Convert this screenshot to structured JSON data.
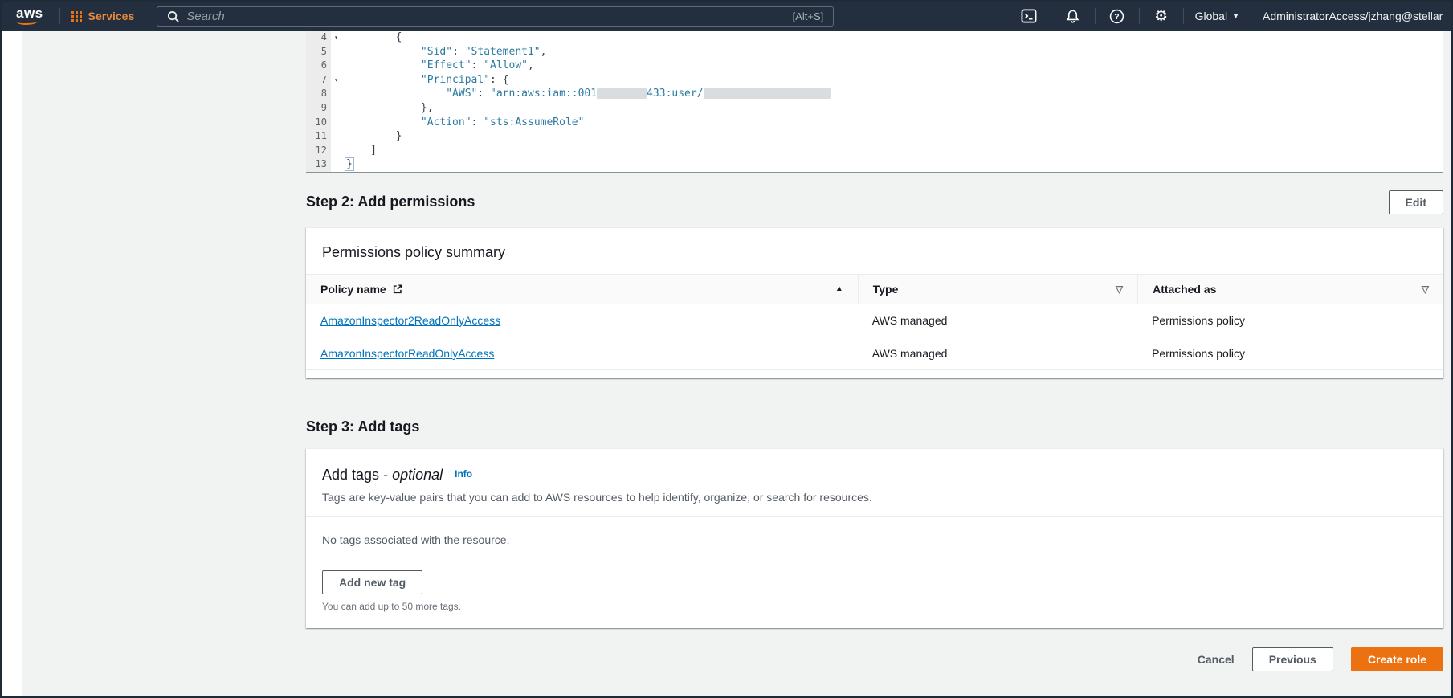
{
  "topbar": {
    "logo_text": "aws",
    "services_label": "Services",
    "search_placeholder": "Search",
    "search_shortcut": "[Alt+S]",
    "region_label": "Global",
    "account_label": "AdministratorAccess/jzhang@stellar"
  },
  "glyphs": {
    "sort_ascending": "▲",
    "filter": "▽",
    "caret_down": "▼",
    "fold_caret": "▾",
    "gear": "⚙"
  },
  "colors": {
    "topbar_navy": "#232f3e",
    "accent_orange": "#ec7211",
    "link_blue": "#0073bb",
    "code_string": "#2d7aa2",
    "page_background": "#f1f3f3"
  },
  "editor": {
    "lines": [
      {
        "num": "4",
        "fold": true,
        "segments": [
          {
            "type": "plain",
            "text": "        {"
          }
        ]
      },
      {
        "num": "5",
        "fold": false,
        "segments": [
          {
            "type": "plain",
            "text": "            "
          },
          {
            "type": "str",
            "text": "\"Sid\""
          },
          {
            "type": "plain",
            "text": ": "
          },
          {
            "type": "str",
            "text": "\"Statement1\""
          },
          {
            "type": "plain",
            "text": ","
          }
        ]
      },
      {
        "num": "6",
        "fold": false,
        "segments": [
          {
            "type": "plain",
            "text": "            "
          },
          {
            "type": "str",
            "text": "\"Effect\""
          },
          {
            "type": "plain",
            "text": ": "
          },
          {
            "type": "str",
            "text": "\"Allow\""
          },
          {
            "type": "plain",
            "text": ","
          }
        ]
      },
      {
        "num": "7",
        "fold": true,
        "segments": [
          {
            "type": "plain",
            "text": "            "
          },
          {
            "type": "str",
            "text": "\"Principal\""
          },
          {
            "type": "plain",
            "text": ": {"
          }
        ]
      },
      {
        "num": "8",
        "fold": false,
        "segments": [
          {
            "type": "plain",
            "text": "                "
          },
          {
            "type": "str",
            "text": "\"AWS\""
          },
          {
            "type": "plain",
            "text": ": "
          },
          {
            "type": "str",
            "text": "\"arn:aws:iam::001"
          },
          {
            "type": "redact",
            "width": 62
          },
          {
            "type": "str",
            "text": "433:user/"
          },
          {
            "type": "redact",
            "width": 158
          }
        ]
      },
      {
        "num": "9",
        "fold": false,
        "segments": [
          {
            "type": "plain",
            "text": "            },"
          }
        ]
      },
      {
        "num": "10",
        "fold": false,
        "segments": [
          {
            "type": "plain",
            "text": "            "
          },
          {
            "type": "str",
            "text": "\"Action\""
          },
          {
            "type": "plain",
            "text": ": "
          },
          {
            "type": "str",
            "text": "\"sts:AssumeRole\""
          }
        ]
      },
      {
        "num": "11",
        "fold": false,
        "segments": [
          {
            "type": "plain",
            "text": "        }"
          }
        ]
      },
      {
        "num": "12",
        "fold": false,
        "segments": [
          {
            "type": "plain",
            "text": "    ]"
          }
        ]
      },
      {
        "num": "13",
        "fold": false,
        "segments": [
          {
            "type": "cursor",
            "text": "}"
          }
        ]
      }
    ]
  },
  "step2": {
    "title": "Step 2: Add permissions",
    "edit_button": "Edit"
  },
  "permissions_card": {
    "title": "Permissions policy summary",
    "columns": [
      {
        "label": "Policy name"
      },
      {
        "label": "Type"
      },
      {
        "label": "Attached as"
      }
    ],
    "rows": [
      {
        "name": "AmazonInspector2ReadOnlyAccess",
        "type": "AWS managed",
        "attached": "Permissions policy"
      },
      {
        "name": "AmazonInspectorReadOnlyAccess",
        "type": "AWS managed",
        "attached": "Permissions policy"
      }
    ]
  },
  "step3": {
    "title": "Step 3: Add tags"
  },
  "tags_card": {
    "title": "Add tags",
    "title_dash": " - ",
    "title_optional": "optional",
    "info_label": "Info",
    "description": "Tags are key-value pairs that you can add to AWS resources to help identify, organize, or search for resources.",
    "empty_text": "No tags associated with the resource.",
    "add_button": "Add new tag",
    "constraint": "You can add up to 50 more tags."
  },
  "footer": {
    "cancel": "Cancel",
    "previous": "Previous",
    "create": "Create role"
  }
}
